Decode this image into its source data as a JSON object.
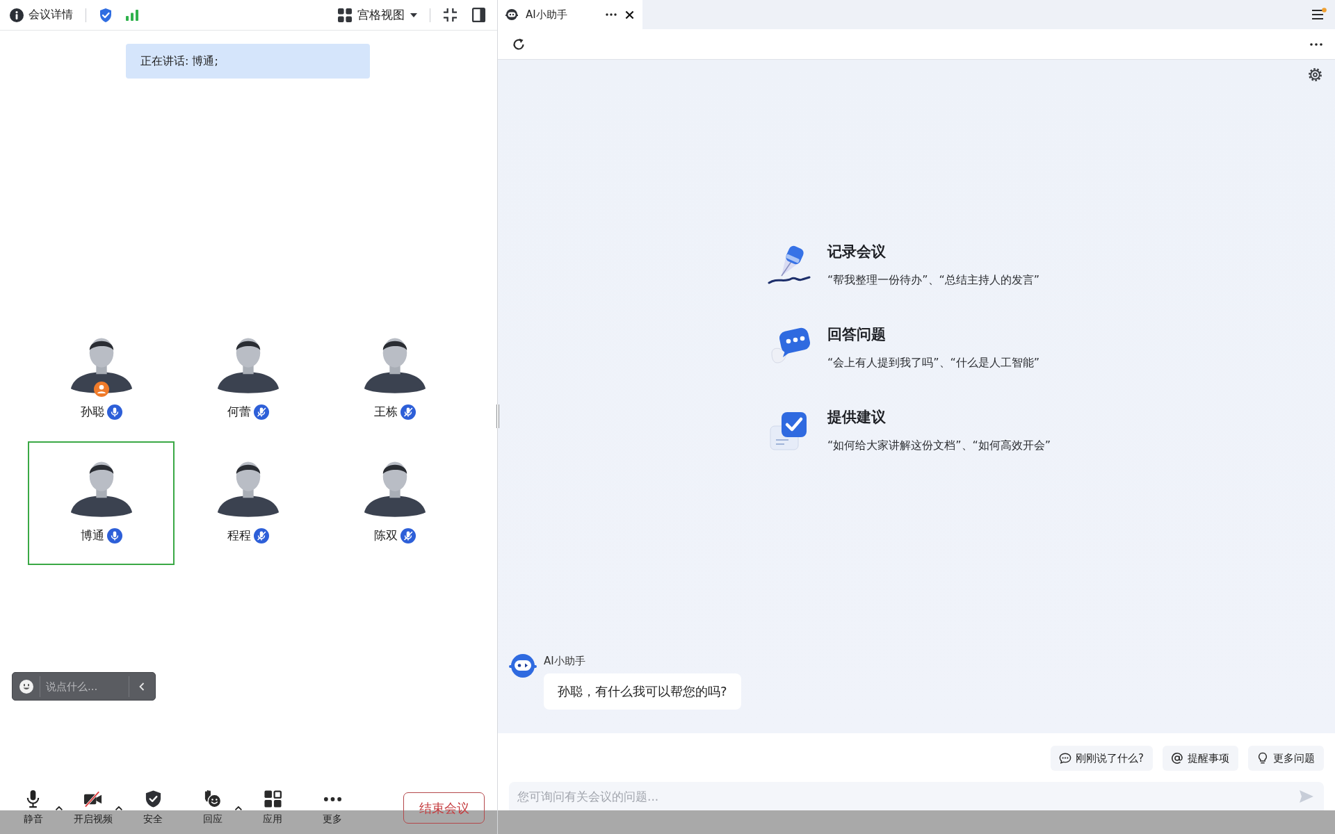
{
  "top_bar": {
    "info_label": "会议详情",
    "view_mode": "宫格视图"
  },
  "speaking_banner": "正在讲话: 博通;",
  "participants": [
    {
      "name": "孙聪",
      "host": true,
      "muted": false,
      "speaking": false
    },
    {
      "name": "何蕾",
      "host": false,
      "muted": true,
      "speaking": false
    },
    {
      "name": "王栋",
      "host": false,
      "muted": true,
      "speaking": false
    },
    {
      "name": "博通",
      "host": false,
      "muted": false,
      "speaking": true
    },
    {
      "name": "程程",
      "host": false,
      "muted": true,
      "speaking": false
    },
    {
      "name": "陈双",
      "host": false,
      "muted": true,
      "speaking": false
    }
  ],
  "chat_box": {
    "placeholder": "说点什么..."
  },
  "controls": [
    {
      "label": "静音",
      "kind": "mic",
      "menu": true
    },
    {
      "label": "开启视频",
      "kind": "video",
      "menu": true
    },
    {
      "label": "安全",
      "kind": "security",
      "menu": false
    },
    {
      "label": "回应",
      "kind": "reaction",
      "menu": true
    },
    {
      "label": "应用",
      "kind": "apps",
      "menu": false
    },
    {
      "label": "更多",
      "kind": "more",
      "menu": false
    }
  ],
  "end_button": "结束会议",
  "assistant": {
    "tabs": [
      {
        "title": "AI小助手",
        "selected": true
      }
    ],
    "menu_badge": true,
    "features": [
      {
        "kind": "pen",
        "title": "记录会议",
        "examples": "“帮我整理一份待办”、“总结主持人的发言”"
      },
      {
        "kind": "chat",
        "title": "回答问题",
        "examples": "“会上有人提到我了吗”、“什么是人工智能”"
      },
      {
        "kind": "check",
        "title": "提供建议",
        "examples": "“如何给大家讲解这份文档”、“如何高效开会”"
      }
    ],
    "message": {
      "sender": "AI小助手",
      "text": "孙聪，有什么我可以帮您的吗?"
    },
    "suggestions": [
      {
        "kind": "chat",
        "label": "刚刚说了什么?"
      },
      {
        "kind": "at",
        "label": "提醒事项"
      },
      {
        "kind": "bulb",
        "label": "更多问题"
      }
    ],
    "input": {
      "placeholder": "您可询问有关会议的问题..."
    }
  }
}
